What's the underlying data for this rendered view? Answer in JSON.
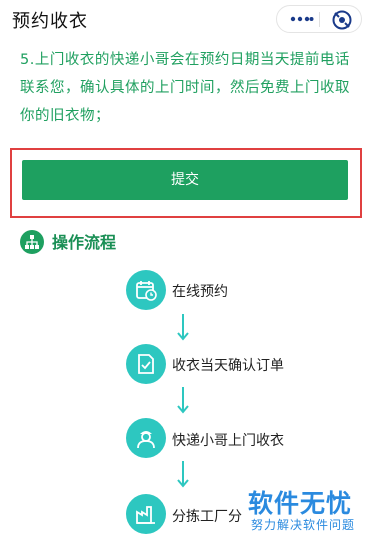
{
  "header": {
    "title": "预约收衣"
  },
  "note": {
    "text": "5.上门收衣的快递小哥会在预约日期当天提前电话联系您，确认具体的上门时间，然后免费上门收取你的旧衣物；"
  },
  "actions": {
    "submit_label": "提交"
  },
  "process": {
    "title": "操作流程",
    "steps": [
      {
        "label": "在线预约",
        "icon": "calendar-icon"
      },
      {
        "label": "收衣当天确认订单",
        "icon": "check-document-icon"
      },
      {
        "label": "快递小哥上门收衣",
        "icon": "courier-icon"
      },
      {
        "label": "分拣工厂分",
        "icon": "factory-icon"
      }
    ]
  },
  "watermark": {
    "title": "软件无忧",
    "subtitle": "努力解决软件问题"
  },
  "colors": {
    "accent_green": "#1ea060",
    "step_teal": "#2dc7c0",
    "highlight_red": "#e04040",
    "watermark_blue": "#2a8adf"
  }
}
